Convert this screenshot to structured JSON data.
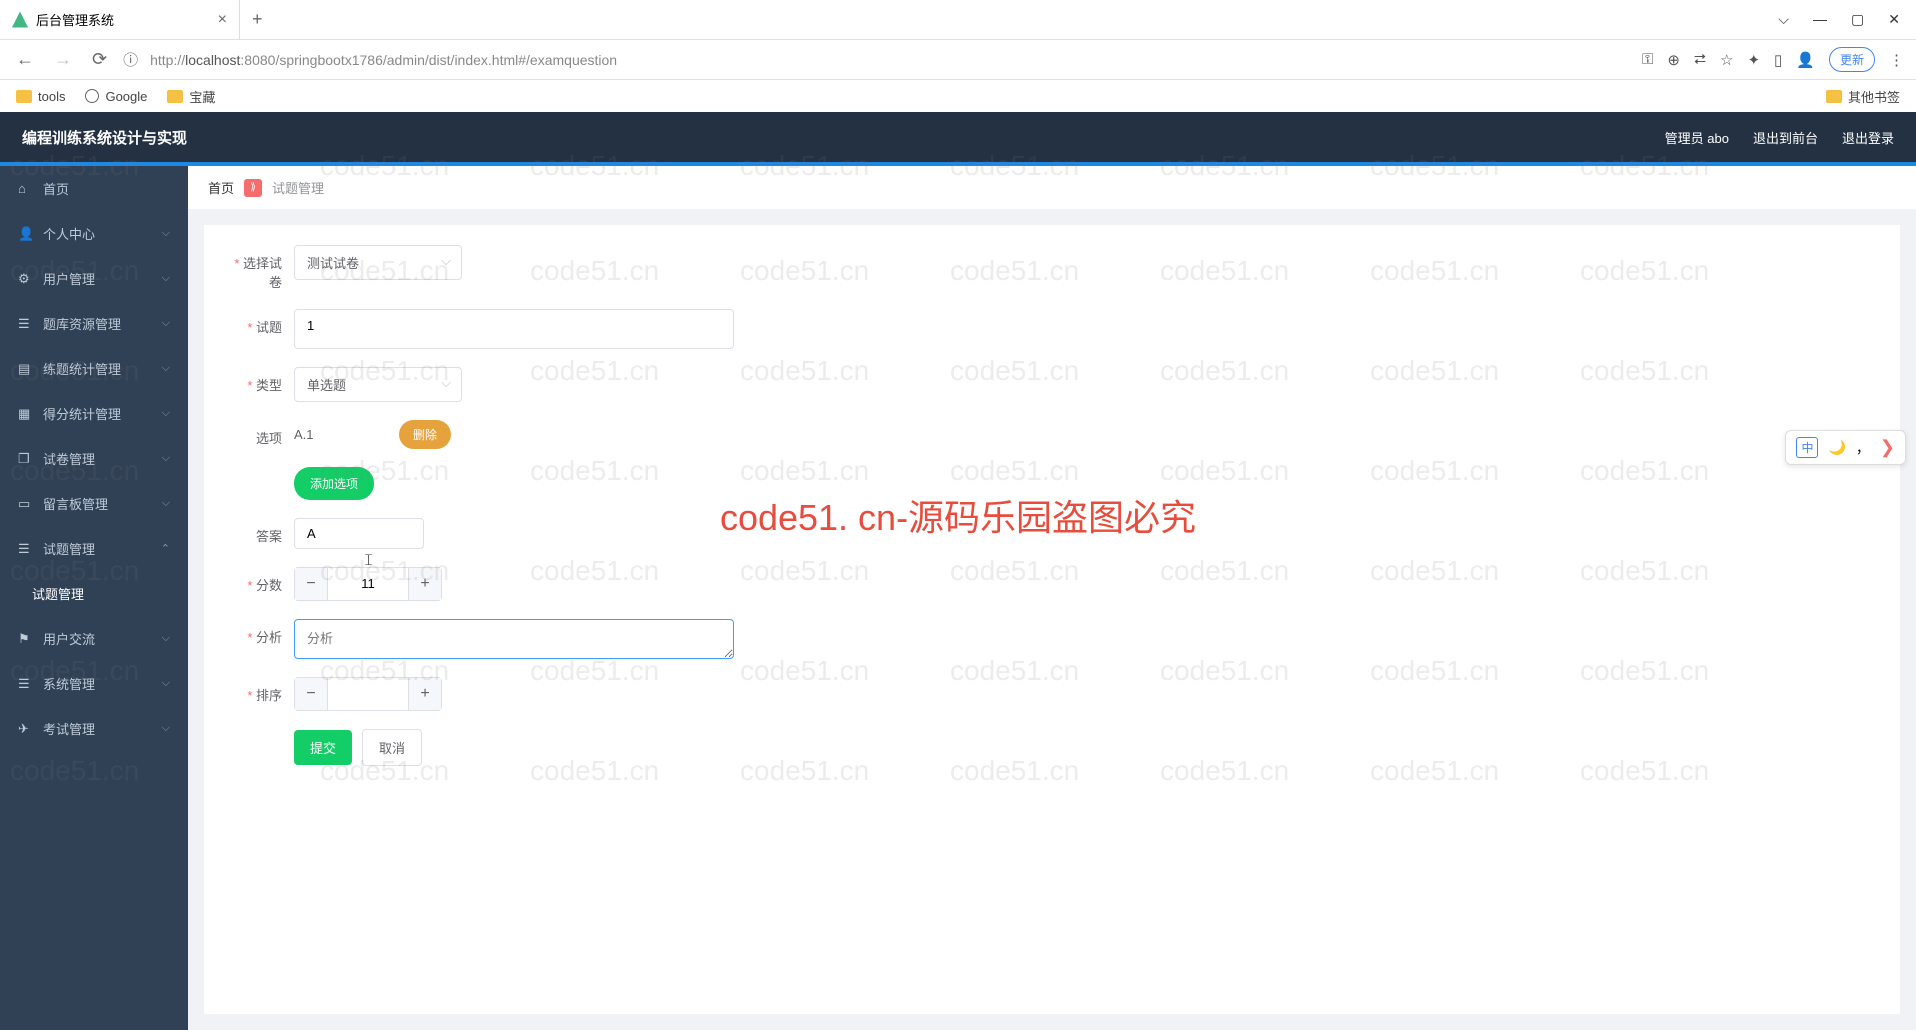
{
  "browser": {
    "tab_title": "后台管理系统",
    "url_prefix": "http://",
    "url_host": "localhost",
    "url_path": ":8080/springbootx1786/admin/dist/index.html#/examquestion",
    "update": "更新",
    "bookmarks": {
      "tools": "tools",
      "google": "Google",
      "treasure": "宝藏",
      "other": "其他书签"
    }
  },
  "header": {
    "title": "编程训练系统设计与实现",
    "admin": "管理员 abo",
    "to_front": "退出到前台",
    "logout": "退出登录"
  },
  "sidebar": {
    "items": [
      {
        "label": "首页",
        "icon": "home"
      },
      {
        "label": "个人中心",
        "icon": "user"
      },
      {
        "label": "用户管理",
        "icon": "gear"
      },
      {
        "label": "题库资源管理",
        "icon": "list"
      },
      {
        "label": "练题统计管理",
        "icon": "doc"
      },
      {
        "label": "得分统计管理",
        "icon": "chart"
      },
      {
        "label": "试卷管理",
        "icon": "copy"
      },
      {
        "label": "留言板管理",
        "icon": "msg"
      },
      {
        "label": "试题管理",
        "icon": "list"
      },
      {
        "label": "试题管理",
        "sub": true
      },
      {
        "label": "用户交流",
        "icon": "flag"
      },
      {
        "label": "系统管理",
        "icon": "list"
      },
      {
        "label": "考试管理",
        "icon": "plane"
      }
    ]
  },
  "crumb": {
    "home": "首页",
    "current": "试题管理"
  },
  "form": {
    "select_paper": {
      "label": "选择试卷",
      "value": "测试试卷"
    },
    "question": {
      "label": "试题",
      "value": "1"
    },
    "type": {
      "label": "类型",
      "value": "单选题"
    },
    "option": {
      "label": "选项",
      "value": "A.1",
      "delete": "删除",
      "add": "添加选项"
    },
    "answer": {
      "label": "答案",
      "value": "A"
    },
    "score": {
      "label": "分数",
      "value": "11"
    },
    "analysis": {
      "label": "分析",
      "placeholder": "分析"
    },
    "sort": {
      "label": "排序",
      "value": ""
    },
    "submit": "提交",
    "cancel": "取消"
  },
  "watermark": "code51. cn-源码乐园盗图必究",
  "wm_small": "code51.cn",
  "ime": {
    "cn": "中",
    "comma": "，"
  }
}
